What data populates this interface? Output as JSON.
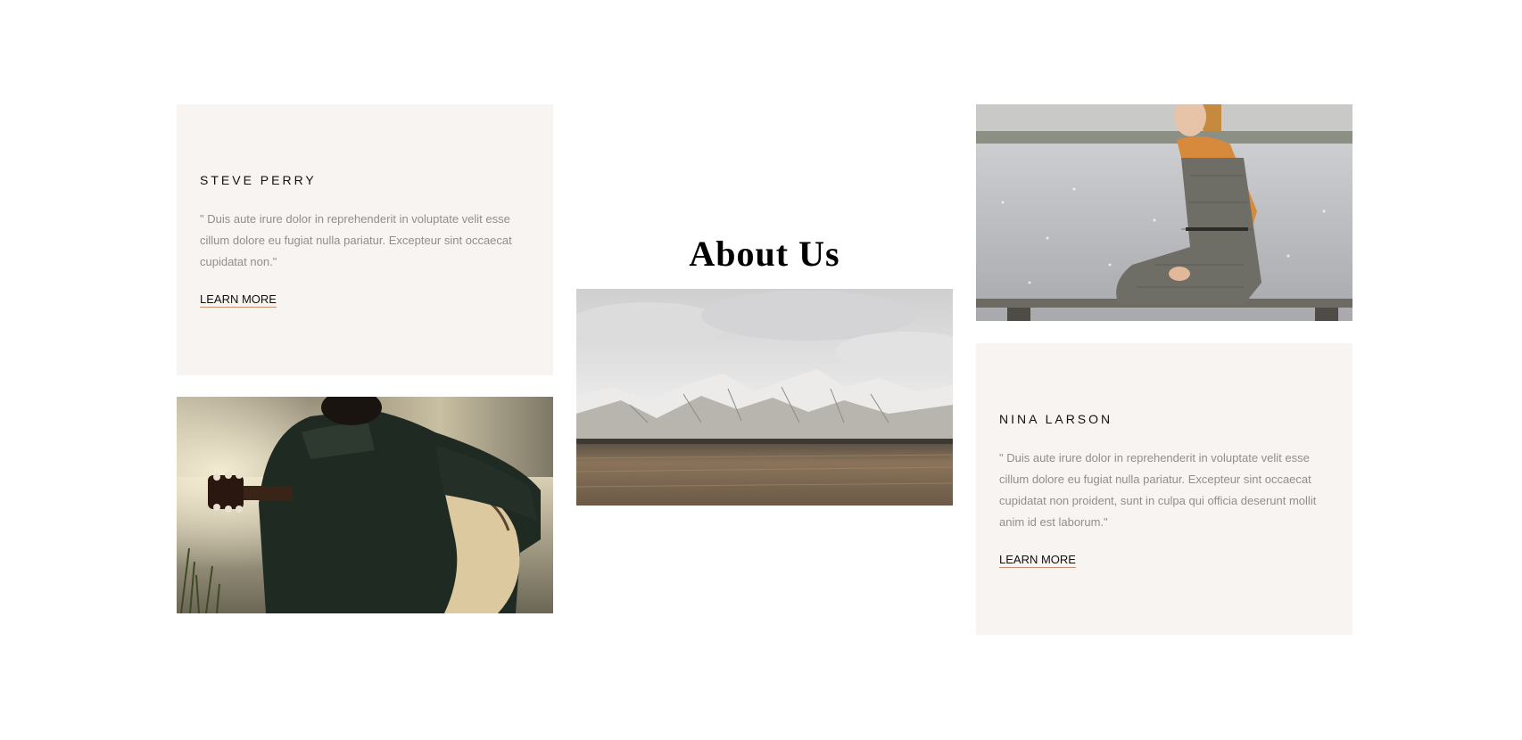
{
  "about": {
    "title": "About Us"
  },
  "cards": [
    {
      "name": "STEVE PERRY",
      "quote": "\" Duis aute irure dolor in reprehenderit in voluptate velit esse cillum dolore eu fugiat nulla pariatur. Excepteur sint occaecat cupidatat non.\"",
      "link_label": "LEARN MORE"
    },
    {
      "name": "NINA LARSON",
      "quote": "\" Duis aute irure dolor in reprehenderit in voluptate velit esse cillum dolore eu fugiat nulla pariatur. Excepteur sint occaecat cupidatat non proident, sunt in culpa qui officia deserunt mollit anim id est laborum.\"",
      "link_label": "LEARN MORE"
    }
  ],
  "photos": [
    {
      "subject": "man-with-guitar-photo"
    },
    {
      "subject": "snowy-mountains-photo"
    },
    {
      "subject": "woman-on-pier-photo"
    }
  ],
  "colors": {
    "card_background": "#f7f4f1",
    "link_underline": "#c98f72",
    "quote_text": "#8f8f8f",
    "heading_text": "#000000"
  }
}
